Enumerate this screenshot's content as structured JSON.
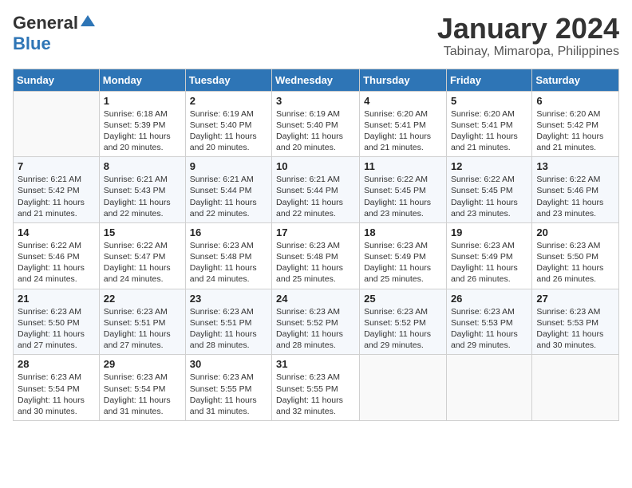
{
  "header": {
    "logo_general": "General",
    "logo_blue": "Blue",
    "month_title": "January 2024",
    "location": "Tabinay, Mimaropa, Philippines"
  },
  "calendar": {
    "days_of_week": [
      "Sunday",
      "Monday",
      "Tuesday",
      "Wednesday",
      "Thursday",
      "Friday",
      "Saturday"
    ],
    "weeks": [
      [
        {
          "day": "",
          "sunrise": "",
          "sunset": "",
          "daylight": ""
        },
        {
          "day": "1",
          "sunrise": "Sunrise: 6:18 AM",
          "sunset": "Sunset: 5:39 PM",
          "daylight": "Daylight: 11 hours and 20 minutes."
        },
        {
          "day": "2",
          "sunrise": "Sunrise: 6:19 AM",
          "sunset": "Sunset: 5:40 PM",
          "daylight": "Daylight: 11 hours and 20 minutes."
        },
        {
          "day": "3",
          "sunrise": "Sunrise: 6:19 AM",
          "sunset": "Sunset: 5:40 PM",
          "daylight": "Daylight: 11 hours and 20 minutes."
        },
        {
          "day": "4",
          "sunrise": "Sunrise: 6:20 AM",
          "sunset": "Sunset: 5:41 PM",
          "daylight": "Daylight: 11 hours and 21 minutes."
        },
        {
          "day": "5",
          "sunrise": "Sunrise: 6:20 AM",
          "sunset": "Sunset: 5:41 PM",
          "daylight": "Daylight: 11 hours and 21 minutes."
        },
        {
          "day": "6",
          "sunrise": "Sunrise: 6:20 AM",
          "sunset": "Sunset: 5:42 PM",
          "daylight": "Daylight: 11 hours and 21 minutes."
        }
      ],
      [
        {
          "day": "7",
          "sunrise": "Sunrise: 6:21 AM",
          "sunset": "Sunset: 5:42 PM",
          "daylight": "Daylight: 11 hours and 21 minutes."
        },
        {
          "day": "8",
          "sunrise": "Sunrise: 6:21 AM",
          "sunset": "Sunset: 5:43 PM",
          "daylight": "Daylight: 11 hours and 22 minutes."
        },
        {
          "day": "9",
          "sunrise": "Sunrise: 6:21 AM",
          "sunset": "Sunset: 5:44 PM",
          "daylight": "Daylight: 11 hours and 22 minutes."
        },
        {
          "day": "10",
          "sunrise": "Sunrise: 6:21 AM",
          "sunset": "Sunset: 5:44 PM",
          "daylight": "Daylight: 11 hours and 22 minutes."
        },
        {
          "day": "11",
          "sunrise": "Sunrise: 6:22 AM",
          "sunset": "Sunset: 5:45 PM",
          "daylight": "Daylight: 11 hours and 23 minutes."
        },
        {
          "day": "12",
          "sunrise": "Sunrise: 6:22 AM",
          "sunset": "Sunset: 5:45 PM",
          "daylight": "Daylight: 11 hours and 23 minutes."
        },
        {
          "day": "13",
          "sunrise": "Sunrise: 6:22 AM",
          "sunset": "Sunset: 5:46 PM",
          "daylight": "Daylight: 11 hours and 23 minutes."
        }
      ],
      [
        {
          "day": "14",
          "sunrise": "Sunrise: 6:22 AM",
          "sunset": "Sunset: 5:46 PM",
          "daylight": "Daylight: 11 hours and 24 minutes."
        },
        {
          "day": "15",
          "sunrise": "Sunrise: 6:22 AM",
          "sunset": "Sunset: 5:47 PM",
          "daylight": "Daylight: 11 hours and 24 minutes."
        },
        {
          "day": "16",
          "sunrise": "Sunrise: 6:23 AM",
          "sunset": "Sunset: 5:48 PM",
          "daylight": "Daylight: 11 hours and 24 minutes."
        },
        {
          "day": "17",
          "sunrise": "Sunrise: 6:23 AM",
          "sunset": "Sunset: 5:48 PM",
          "daylight": "Daylight: 11 hours and 25 minutes."
        },
        {
          "day": "18",
          "sunrise": "Sunrise: 6:23 AM",
          "sunset": "Sunset: 5:49 PM",
          "daylight": "Daylight: 11 hours and 25 minutes."
        },
        {
          "day": "19",
          "sunrise": "Sunrise: 6:23 AM",
          "sunset": "Sunset: 5:49 PM",
          "daylight": "Daylight: 11 hours and 26 minutes."
        },
        {
          "day": "20",
          "sunrise": "Sunrise: 6:23 AM",
          "sunset": "Sunset: 5:50 PM",
          "daylight": "Daylight: 11 hours and 26 minutes."
        }
      ],
      [
        {
          "day": "21",
          "sunrise": "Sunrise: 6:23 AM",
          "sunset": "Sunset: 5:50 PM",
          "daylight": "Daylight: 11 hours and 27 minutes."
        },
        {
          "day": "22",
          "sunrise": "Sunrise: 6:23 AM",
          "sunset": "Sunset: 5:51 PM",
          "daylight": "Daylight: 11 hours and 27 minutes."
        },
        {
          "day": "23",
          "sunrise": "Sunrise: 6:23 AM",
          "sunset": "Sunset: 5:51 PM",
          "daylight": "Daylight: 11 hours and 28 minutes."
        },
        {
          "day": "24",
          "sunrise": "Sunrise: 6:23 AM",
          "sunset": "Sunset: 5:52 PM",
          "daylight": "Daylight: 11 hours and 28 minutes."
        },
        {
          "day": "25",
          "sunrise": "Sunrise: 6:23 AM",
          "sunset": "Sunset: 5:52 PM",
          "daylight": "Daylight: 11 hours and 29 minutes."
        },
        {
          "day": "26",
          "sunrise": "Sunrise: 6:23 AM",
          "sunset": "Sunset: 5:53 PM",
          "daylight": "Daylight: 11 hours and 29 minutes."
        },
        {
          "day": "27",
          "sunrise": "Sunrise: 6:23 AM",
          "sunset": "Sunset: 5:53 PM",
          "daylight": "Daylight: 11 hours and 30 minutes."
        }
      ],
      [
        {
          "day": "28",
          "sunrise": "Sunrise: 6:23 AM",
          "sunset": "Sunset: 5:54 PM",
          "daylight": "Daylight: 11 hours and 30 minutes."
        },
        {
          "day": "29",
          "sunrise": "Sunrise: 6:23 AM",
          "sunset": "Sunset: 5:54 PM",
          "daylight": "Daylight: 11 hours and 31 minutes."
        },
        {
          "day": "30",
          "sunrise": "Sunrise: 6:23 AM",
          "sunset": "Sunset: 5:55 PM",
          "daylight": "Daylight: 11 hours and 31 minutes."
        },
        {
          "day": "31",
          "sunrise": "Sunrise: 6:23 AM",
          "sunset": "Sunset: 5:55 PM",
          "daylight": "Daylight: 11 hours and 32 minutes."
        },
        {
          "day": "",
          "sunrise": "",
          "sunset": "",
          "daylight": ""
        },
        {
          "day": "",
          "sunrise": "",
          "sunset": "",
          "daylight": ""
        },
        {
          "day": "",
          "sunrise": "",
          "sunset": "",
          "daylight": ""
        }
      ]
    ]
  }
}
